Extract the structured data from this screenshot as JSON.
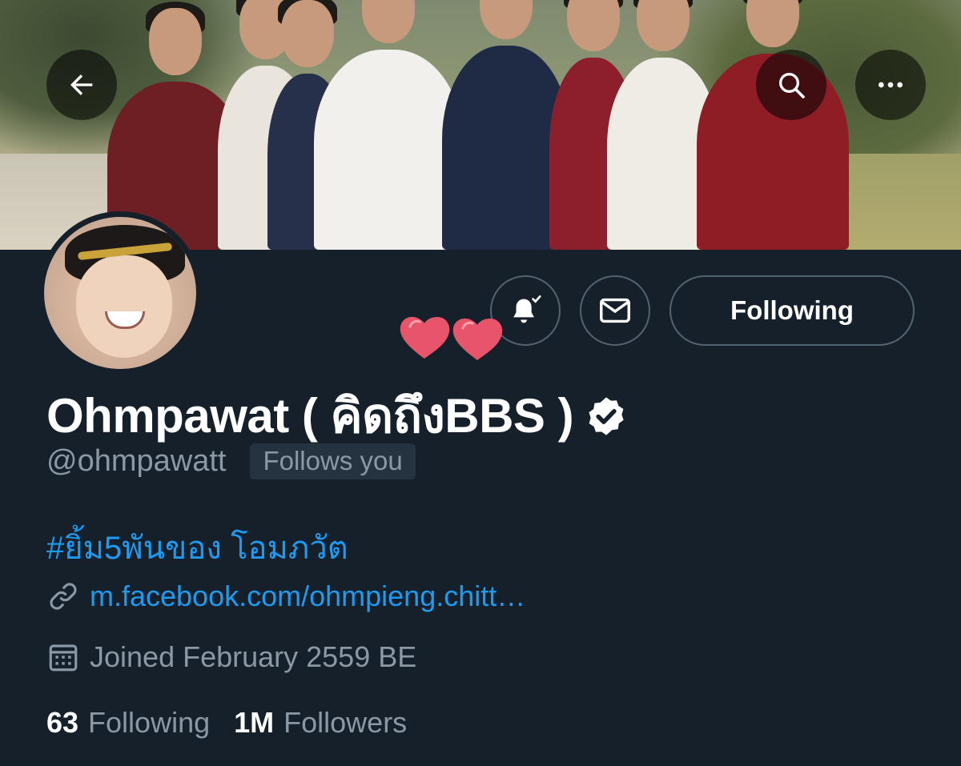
{
  "profile": {
    "display_name": "Ohmpawat ( คิดถึงBBS )",
    "handle": "@ohmpawatt",
    "follows_you": "Follows you",
    "bio": "#ยิ้ม5พันของ โอมภวัต",
    "link": "m.facebook.com/ohmpieng.chitt…",
    "joined": "Joined February 2559 BE",
    "verified": true
  },
  "actions": {
    "follow_label": "Following"
  },
  "stats": {
    "following_count": "63",
    "following_label": "Following",
    "followers_count": "1M",
    "followers_label": "Followers"
  },
  "icons": {
    "back": "arrow-left-icon",
    "search": "search-icon",
    "more": "more-dots-icon",
    "notifications": "bell-check-icon",
    "message": "envelope-icon",
    "link": "link-icon",
    "calendar": "calendar-icon",
    "verified": "verified-badge-icon",
    "hearts": "hearts-sticker"
  },
  "colors": {
    "background": "#15202b",
    "accent": "#1d9bf0",
    "secondary_text": "#8b98a5",
    "border": "#536471",
    "heart": "#e8546a"
  }
}
